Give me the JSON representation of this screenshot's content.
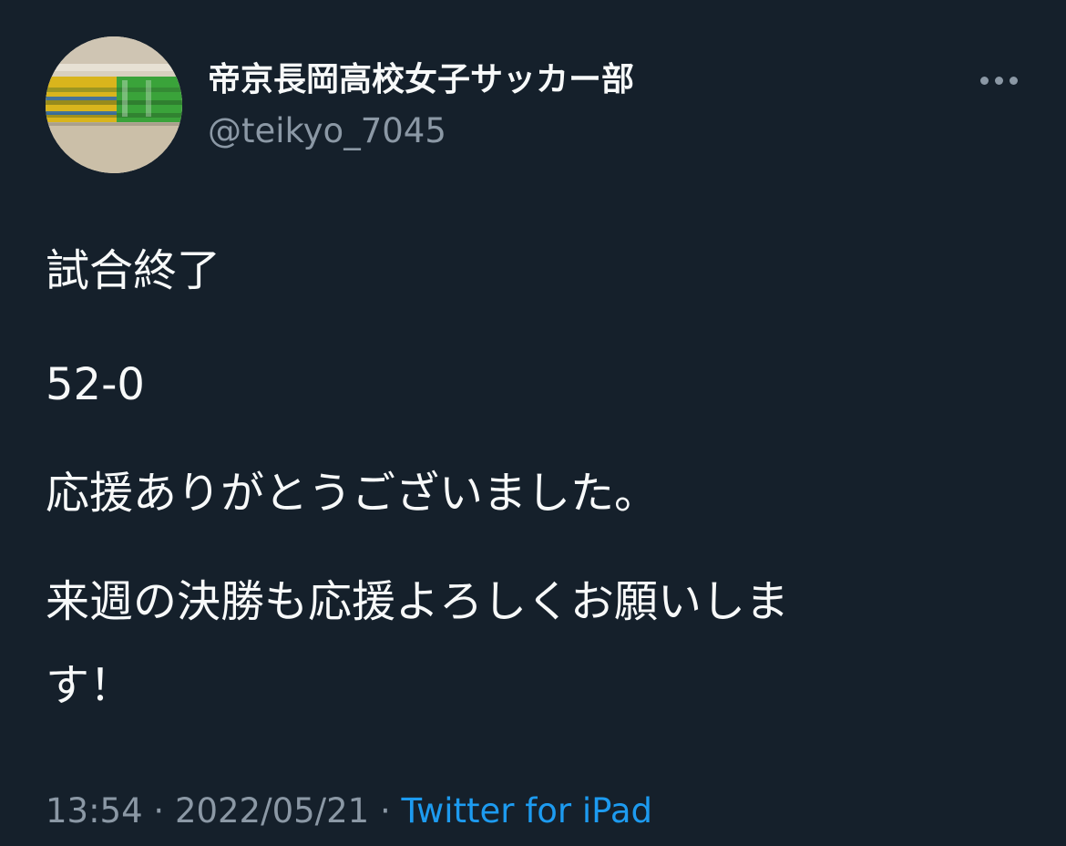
{
  "user": {
    "display_name": "帝京長岡高校女子サッカー部",
    "handle": "@teikyo_7045",
    "avatar_icon": "team-photo-avatar"
  },
  "more_icon": "more-horizontal-icon",
  "tweet": {
    "lines": [
      "試合終了",
      "52-0",
      "応援ありがとうございました。",
      "来週の決勝も応援よろしくお願いしま",
      "す！"
    ]
  },
  "meta": {
    "time": "13:54",
    "separator": " · ",
    "date": "2022/05/21",
    "source": "Twitter for iPad"
  },
  "colors": {
    "background": "#15202b",
    "text": "#f7f9f9",
    "secondary": "#8b98a5",
    "link": "#1d9bf0"
  }
}
